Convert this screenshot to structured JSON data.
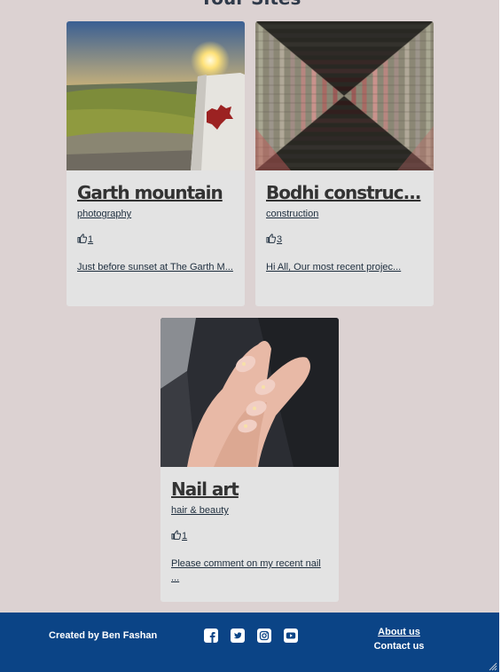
{
  "page": {
    "heading": "Your Sites"
  },
  "cards": [
    {
      "title": "Garth mountain",
      "category": "photography",
      "likes": "1",
      "excerpt": "Just before sunset at The Garth M..."
    },
    {
      "title": "Bodhi construc...",
      "category": "construction",
      "likes": "3",
      "excerpt": "Hi All, Our most recent projec..."
    },
    {
      "title": "Nail art",
      "category": "hair & beauty",
      "likes": "1",
      "excerpt": "Please comment on my recent nail ..."
    }
  ],
  "footer": {
    "credit": "Created by Ben Fashan",
    "social": [
      "facebook-icon",
      "twitter-icon",
      "instagram-icon",
      "youtube-icon"
    ],
    "about": "About us",
    "contact": "Contact us"
  },
  "colors": {
    "background": "#dcd2d2",
    "card": "#e3e3e3",
    "footer": "#0b4486"
  }
}
